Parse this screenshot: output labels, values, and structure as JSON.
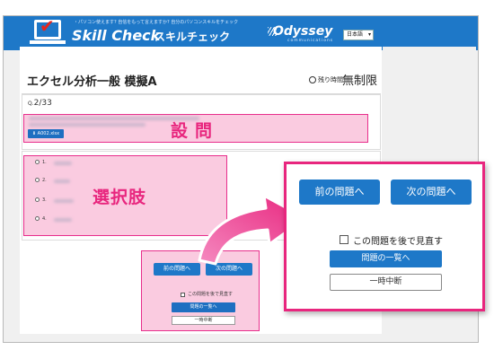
{
  "header": {
    "tagline": "・パソコン使えます? 自信をもって言えますか? 自分のパソコンスキルをチェック",
    "app_name": "Skill Check",
    "app_name_kana": "スキルチェック",
    "brand": "Odyssey",
    "brand_sub": "communications",
    "language": "日本語",
    "brand_color": "#1e78c8"
  },
  "exam": {
    "title": "エクセル分析一般 模擬A",
    "remaining_label": "残り時間",
    "remaining_value": "無制限"
  },
  "question": {
    "prefix": "Q.",
    "number": "2/33",
    "file_button": "A002.xlsx"
  },
  "choices": {
    "numbers": [
      "1.",
      "2.",
      "3.",
      "4."
    ]
  },
  "highlights": {
    "question_label": "設問",
    "choices_label": "選択肢",
    "color": "#e8267e"
  },
  "navigation": {
    "prev": "前の問題へ",
    "next": "次の問題へ",
    "review": "この問題を後で見直す",
    "list": "問題の一覧へ",
    "pause": "一時中断"
  }
}
